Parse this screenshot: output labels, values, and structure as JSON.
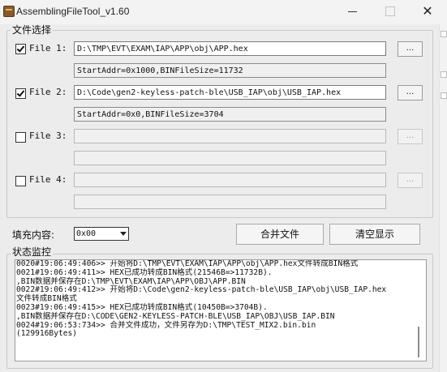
{
  "window": {
    "title": "AssemblingFileTool_v1.60"
  },
  "file_group": {
    "label": "文件选择",
    "rows": [
      {
        "checked": true,
        "label": "File 1:",
        "path": "D:\\TMP\\EVT\\EXAM\\IAP\\APP\\obj\\APP.hex",
        "info": "StartAddr=0x1000,BINFileSize=11732",
        "browse": "...",
        "enabled": true
      },
      {
        "checked": true,
        "label": "File 2:",
        "path": "D:\\Code\\gen2-keyless-patch-ble\\USB_IAP\\obj\\USB_IAP.hex",
        "info": "StartAddr=0x0,BINFileSize=3704",
        "browse": "...",
        "enabled": true
      },
      {
        "checked": false,
        "label": "File 3:",
        "path": "",
        "info": "",
        "browse": "...",
        "enabled": false
      },
      {
        "checked": false,
        "label": "File 4:",
        "path": "",
        "info": "",
        "browse": "...",
        "enabled": false
      }
    ]
  },
  "controls": {
    "fill_label": "填充内容:",
    "fill_value": "0x00",
    "merge_button": "合并文件",
    "clear_button": "清空显示"
  },
  "status_group": {
    "label": "状态监控",
    "log_lines": [
      "0020#19:06:49:406>> 开始将D:\\TMP\\EVT\\EXAM\\IAP\\APP\\obj\\APP.hex文件转成BIN格式",
      "0021#19:06:49:411>> HEX已成功转成BIN格式(21546B=>11732B).",
      ",BIN数据并保存在D:\\TMP\\EVT\\EXAM\\IAP\\APP\\OBJ\\APP.BIN",
      "0022#19:06:49:412>> 开始将D:\\Code\\gen2-keyless-patch-ble\\USB_IAP\\obj\\USB_IAP.hex",
      "文件转成BIN格式",
      "0023#19:06:49:415>> HEX已成功转成BIN格式(10450B=>3704B).",
      ",BIN数据并保存在D:\\CODE\\GEN2-KEYLESS-PATCH-BLE\\USB_IAP\\OBJ\\USB_IAP.BIN",
      "0024#19:06:53:734>> 合并文件成功，文件另存为D:\\TMP\\TEST_MIX2.bin.bin",
      "(129916Bytes)"
    ]
  }
}
